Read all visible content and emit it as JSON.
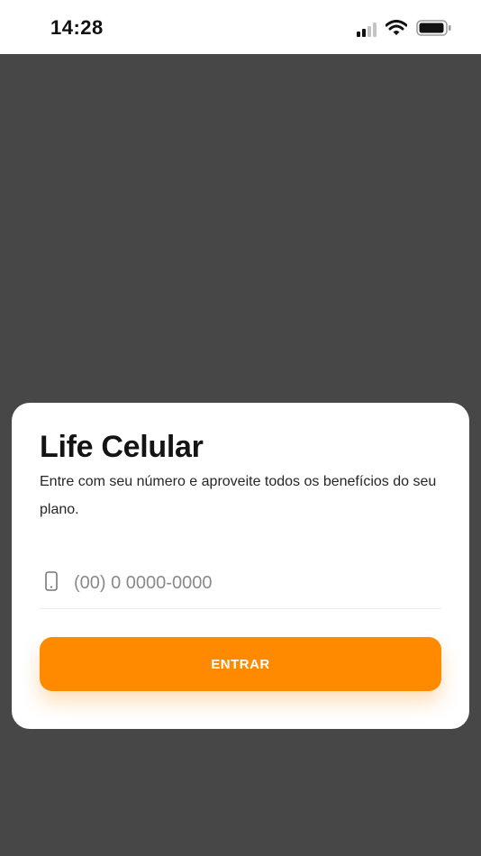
{
  "status_bar": {
    "time": "14:28",
    "icons": [
      "cellular-signal-icon",
      "wifi-icon",
      "battery-icon"
    ]
  },
  "login": {
    "title": "Life Celular",
    "description": "Entre com seu número e aproveite todos os benefícios do seu plano.",
    "phone_placeholder": "(00) 0 0000-0000",
    "phone_value": "",
    "phone_icon": "smartphone-icon",
    "submit_label": "ENTRAR"
  },
  "colors": {
    "background": "#474747",
    "card": "#ffffff",
    "accent": "#ff8a00",
    "button_text": "#ffffff"
  }
}
